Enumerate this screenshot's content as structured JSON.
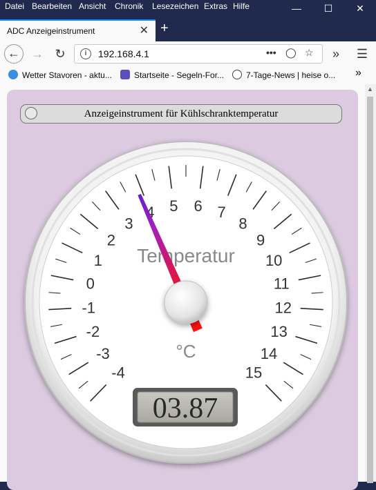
{
  "menubar": {
    "items": [
      "Datei",
      "Bearbeiten",
      "Ansicht",
      "Chronik",
      "Lesezeichen",
      "Extras",
      "Hilfe"
    ]
  },
  "tab": {
    "title": "ADC Anzeigeinstrument"
  },
  "address": {
    "url": "192.168.4.1"
  },
  "bookmarks": [
    {
      "label": "Wetter Stavoren - aktu...",
      "icon": "weather-icon",
      "color": "#3a8de0"
    },
    {
      "label": "Startseite - Segeln-For...",
      "icon": "forum-icon",
      "color": "#5a4fc0"
    },
    {
      "label": "7-Tage-News | heise o...",
      "icon": "heise-icon",
      "color": "#444444"
    }
  ],
  "page": {
    "header_title": "Anzeigeinstrument für Kühlschranktemperatur"
  },
  "gauge": {
    "title": "Temperatur",
    "unit": "°C",
    "min": -4,
    "max": 15,
    "tick_labels": [
      "-4",
      "-3",
      "-2",
      "-1",
      "0",
      "1",
      "2",
      "3",
      "4",
      "5",
      "6",
      "7",
      "8",
      "9",
      "10",
      "11",
      "12",
      "13",
      "14",
      "15"
    ],
    "value": 3.87,
    "display": "03.87",
    "colors": {
      "needle_top": "#2a1ae0",
      "needle_bottom": "#ff1010",
      "background": "#dccbe0"
    }
  }
}
